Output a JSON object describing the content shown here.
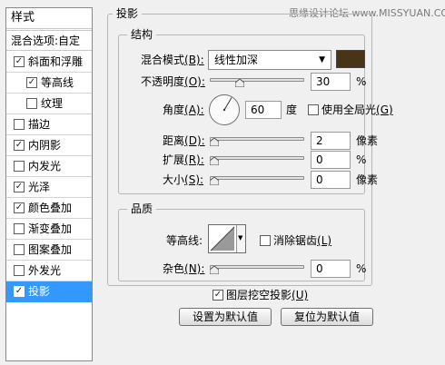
{
  "watermark": "思缘设计论坛 www.MISSYUAN.COM",
  "sidebar": {
    "header": "样式",
    "blend_options": "混合选项:自定",
    "items": [
      {
        "label": "斜面和浮雕",
        "checked": true
      },
      {
        "label": "等高线",
        "checked": true
      },
      {
        "label": "纹理",
        "checked": false
      },
      {
        "label": "描边",
        "checked": false
      },
      {
        "label": "内阴影",
        "checked": true
      },
      {
        "label": "内发光",
        "checked": false
      },
      {
        "label": "光泽",
        "checked": true
      },
      {
        "label": "颜色叠加",
        "checked": true
      },
      {
        "label": "渐变叠加",
        "checked": false
      },
      {
        "label": "图案叠加",
        "checked": false
      },
      {
        "label": "外发光",
        "checked": false
      },
      {
        "label": "投影",
        "checked": true,
        "selected": true
      }
    ]
  },
  "panel": {
    "title": "投影",
    "structure": {
      "title": "结构",
      "blend_mode_label": "混合模式",
      "blend_mode_key": "(B):",
      "blend_mode_value": "线性加深",
      "blend_color": "#4a3418",
      "opacity_label": "不透明度",
      "opacity_key": "(O):",
      "opacity_value": "30",
      "opacity_unit": "%",
      "angle_label": "角度",
      "angle_key": "(A):",
      "angle_value": "60",
      "angle_unit": "度",
      "global_light_label": "使用全局光",
      "global_light_key": "(G)",
      "global_light_checked": false,
      "distance_label": "距离",
      "distance_key": "(D):",
      "distance_value": "2",
      "distance_unit": "像素",
      "spread_label": "扩展",
      "spread_key": "(R):",
      "spread_value": "0",
      "spread_unit": "%",
      "size_label": "大小",
      "size_key": "(S):",
      "size_value": "0",
      "size_unit": "像素"
    },
    "quality": {
      "title": "品质",
      "contour_label": "等高线:",
      "antialias_label": "消除锯齿",
      "antialias_key": "(L)",
      "antialias_checked": false,
      "noise_label": "杂色",
      "noise_key": "(N):",
      "noise_value": "0",
      "noise_unit": "%"
    },
    "knockout_label": "图层挖空投影",
    "knockout_key": "(U)",
    "knockout_checked": true,
    "btn_default": "设置为默认值",
    "btn_reset": "复位为默认值"
  }
}
